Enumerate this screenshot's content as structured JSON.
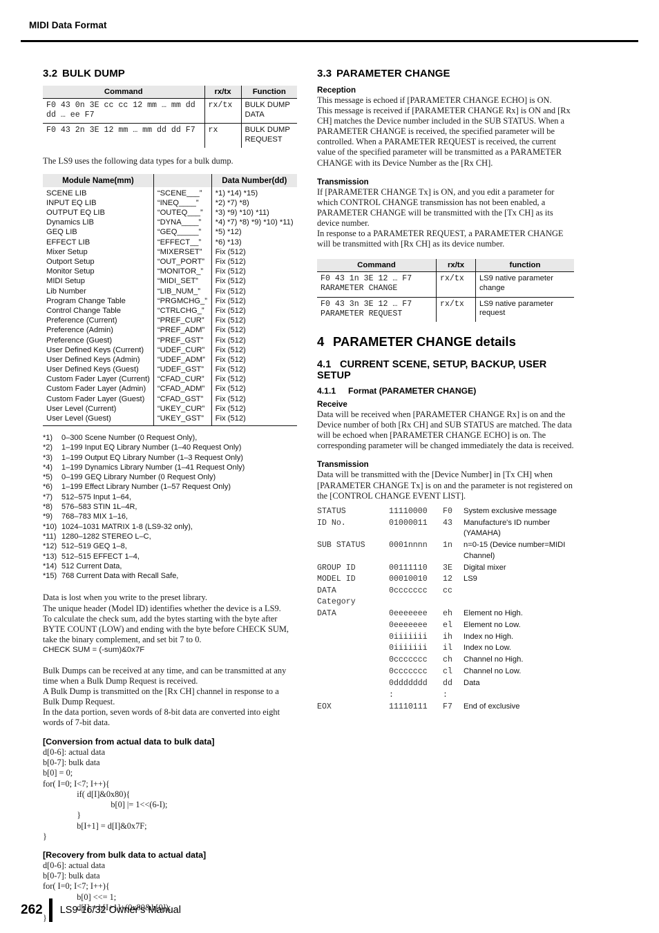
{
  "header": {
    "running_head": "MIDI Data Format"
  },
  "footer": {
    "page_number": "262",
    "manual_title": "LS9-16/32  Owner's Manual"
  },
  "left": {
    "bulk_dump": {
      "num": "3.2",
      "title": "BULK DUMP",
      "command_table": {
        "headers": [
          "Command",
          "rx/tx",
          "Function"
        ],
        "rows": [
          {
            "command": "F0 43 0n 3E cc cc 12 mm … mm dd\ndd … ee F7",
            "rxtx": "rx/tx",
            "function": "BULK DUMP DATA"
          },
          {
            "command": "F0 43 2n 3E 12 mm … mm dd dd F7",
            "rxtx": "rx",
            "function": "BULK DUMP REQUEST"
          }
        ]
      },
      "intro": "The LS9 uses the following data types for a bulk dump.",
      "module_table": {
        "headers": [
          "Module Name(mm)",
          "",
          "Data Number(dd)"
        ],
        "rows": [
          [
            "SCENE LIB",
            "“SCENE___”",
            "*1) *14) *15)"
          ],
          [
            "INPUT EQ LIB",
            "“INEQ____”",
            "*2) *7) *8)"
          ],
          [
            "OUTPUT EQ LIB",
            "“OUTEQ___”",
            "*3) *9) *10) *11)"
          ],
          [
            "Dynamics LIB",
            "“DYNA____”",
            "*4) *7) *8) *9) *10) *11)"
          ],
          [
            "GEQ LIB",
            "“GEQ_____”",
            "*5) *12)"
          ],
          [
            "EFFECT LIB",
            "“EFFECT__”",
            "*6) *13)"
          ],
          [
            "Mixer Setup",
            "“MIXERSET”",
            "Fix (512)"
          ],
          [
            "Outport Setup",
            "“OUT_PORT”",
            "Fix (512)"
          ],
          [
            "Monitor Setup",
            "“MONITOR_”",
            "Fix (512)"
          ],
          [
            "MIDI Setup",
            "“MIDI_SET”",
            "Fix (512)"
          ],
          [
            "Lib Number",
            "“LIB_NUM_”",
            "Fix (512)"
          ],
          [
            "Program Change Table",
            "“PRGMCHG_”",
            "Fix (512)"
          ],
          [
            "Control Change Table",
            "“CTRLCHG_”",
            "Fix (512)"
          ],
          [
            "Preference (Current)",
            "“PREF_CUR”",
            "Fix (512)"
          ],
          [
            "Preference (Admin)",
            "“PREF_ADM”",
            "Fix (512)"
          ],
          [
            "Preference (Guest)",
            "“PREF_GST”",
            "Fix (512)"
          ],
          [
            "User Defined Keys (Current)",
            "“UDEF_CUR”",
            "Fix (512)"
          ],
          [
            "User Defined Keys (Admin)",
            "“UDEF_ADM”",
            "Fix (512)"
          ],
          [
            "User Defined Keys (Guest)",
            "“UDEF_GST”",
            "Fix (512)"
          ],
          [
            "Custom Fader Layer (Current)",
            "“CFAD_CUR”",
            "Fix (512)"
          ],
          [
            "Custom Fader Layer (Admin)",
            "“CFAD_ADM”",
            "Fix (512)"
          ],
          [
            "Custom Fader Layer (Guest)",
            "“CFAD_GST”",
            "Fix (512)"
          ],
          [
            "User Level (Current)",
            "“UKEY_CUR”",
            "Fix (512)"
          ],
          [
            "User Level (Guest)",
            "“UKEY_GST”",
            "Fix (512)"
          ]
        ]
      },
      "notes": [
        {
          "mark": "*1)",
          "text": "0–300 Scene Number (0 Request Only),"
        },
        {
          "mark": "*2)",
          "text": "1–199 Input EQ Library Number (1–40 Request Only)"
        },
        {
          "mark": "*3)",
          "text": "1–199 Output EQ Library Number (1–3 Request Only)"
        },
        {
          "mark": "*4)",
          "text": "1–199 Dynamics Library Number (1–41 Request Only)"
        },
        {
          "mark": "*5)",
          "text": "0–199 GEQ Library Number (0 Request Only)"
        },
        {
          "mark": "*6)",
          "text": "1–199 Effect Library Number (1–57 Request Only)"
        },
        {
          "mark": "*7)",
          "text": "512–575 Input  1–64,"
        },
        {
          "mark": "*8)",
          "text": "576–583 STIN  1L–4R,"
        },
        {
          "mark": "*9)",
          "text": "768–783  MIX 1–16,"
        },
        {
          "mark": "*10)",
          "text": "1024–1031 MATRIX 1-8 (LS9-32 only),"
        },
        {
          "mark": "*11)",
          "text": "1280–1282 STEREO L–C,"
        },
        {
          "mark": "*12)",
          "text": "512–519 GEQ 1–8,"
        },
        {
          "mark": "*13)",
          "text": "512–515 EFFECT 1–4,"
        },
        {
          "mark": "*14)",
          "text": "512 Current Data,"
        },
        {
          "mark": "*15)",
          "text": "768 Current Data with Recall Safe,"
        }
      ],
      "para1": "Data is lost when you write to the preset library.\nThe unique header (Model ID) identifies whether the device is a LS9.\nTo calculate the check sum, add the bytes starting with the byte after BYTE COUNT (LOW) and ending with the byte before CHECK SUM, take the binary complement, and set bit 7 to 0.",
      "checksum_line": "CHECK SUM = (-sum)&0x7F",
      "para2": "Bulk Dumps can be received at any time, and can be transmitted at any time when a Bulk Dump Request is received.\nA Bulk Dump is transmitted on the [Rx CH] channel in response to a Bulk Dump Request.\nIn the data portion, seven words of 8-bit data are converted into eight words of 7-bit data.",
      "conversion_heading": "[Conversion from actual data to bulk data]",
      "conversion_code": "d[0-6]: actual data\nb[0-7]: bulk data\nb[0] = 0;\nfor( I=0; I<7; I++){\n                if( d[I]&0x80){\n                                b[0] |= 1<<(6-I);\n                }\n                b[I+1] = d[I]&0x7F;\n}",
      "recovery_heading": "[Recovery from bulk data to actual data]",
      "recovery_code": "d[0-6]: actual data\nb[0-7]: bulk data\nfor( I=0; I<7; I++){\n                b[0] <<= 1;\n                d[I] = b[I+1]+(0x80&b[0]);\n}"
    }
  },
  "right": {
    "parameter_change": {
      "num": "3.3",
      "title": "PARAMETER CHANGE",
      "reception_heading": "Reception",
      "reception_text": "This message is echoed if [PARAMETER CHANGE ECHO] is ON.\nThis message is received if [PARAMETER CHANGE Rx] is ON and [Rx CH] matches the Device number included in the SUB STATUS. When a PARAMETER CHANGE is received, the specified parameter will be controlled. When a PARAMETER REQUEST is received, the current value of the specified parameter will be transmitted as a PARAMETER CHANGE with its Device Number as the [Rx CH].",
      "transmission_heading": "Transmission",
      "transmission_text": "If [PARAMETER CHANGE Tx] is ON, and you edit a parameter for which CONTROL CHANGE transmission has not been enabled, a PARAMETER CHANGE will be transmitted with the [Tx CH] as its device number.\nIn response to a PARAMETER REQUEST, a PARAMETER CHANGE will be transmitted with [Rx CH] as its device number.",
      "command_table": {
        "headers": [
          "Command",
          "rx/tx",
          "function"
        ],
        "rows": [
          {
            "command": "F0 43 1n 3E 12 … F7\nRARAMETER CHANGE",
            "rxtx": "rx/tx",
            "function": "LS9 native parameter change"
          },
          {
            "command": "F0 43 3n 3E 12 … F7\nPARAMETER REQUEST",
            "rxtx": "rx/tx",
            "function": "LS9 native parameter request"
          }
        ]
      }
    },
    "details": {
      "num": "4",
      "title": "PARAMETER CHANGE details",
      "sub_num": "4.1",
      "sub_title": "CURRENT SCENE, SETUP, BACKUP, USER SETUP",
      "subsub_num": "4.1.1",
      "subsub_title": "Format (PARAMETER CHANGE)",
      "receive_heading": "Receive",
      "receive_text": "Data will be received when [PARAMETER CHANGE Rx] is on and the Device number of both [Rx CH] and SUB STATUS are matched. The data will be echoed when [PARAMETER CHANGE ECHO] is on. The corresponding parameter will be changed immediately the data is received.",
      "transmission_heading": "Transmission",
      "transmission_text": "Data will be transmitted with the [Device Number] in [Tx CH] when [PARAMETER CHANGE Tx] is on and the parameter is not registered on the [CONTROL CHANGE EVENT LIST].",
      "format_rows": [
        {
          "label": "STATUS",
          "binary": "11110000",
          "hex": "F0",
          "desc": "System exclusive message"
        },
        {
          "label": "ID No.",
          "binary": "01000011",
          "hex": "43",
          "desc": "Manufacture's ID number (YAMAHA)"
        },
        {
          "label": "SUB STATUS",
          "binary": "0001nnnn",
          "hex": "1n",
          "desc": "n=0-15 (Device number=MIDI Channel)"
        },
        {
          "label": "GROUP ID",
          "binary": "00111110",
          "hex": "3E",
          "desc": "Digital mixer"
        },
        {
          "label": "MODEL ID",
          "binary": "00010010",
          "hex": "12",
          "desc": "LS9"
        },
        {
          "label": "DATA\nCategory",
          "binary": "0ccccccc",
          "hex": "cc",
          "desc": ""
        },
        {
          "label": "DATA",
          "binary": "0eeeeeee",
          "hex": "eh",
          "desc": "Element no High."
        },
        {
          "label": "",
          "binary": "0eeeeeee",
          "hex": "el",
          "desc": "Element no Low."
        },
        {
          "label": "",
          "binary": "0iiiiiii",
          "hex": "ih",
          "desc": "Index no High."
        },
        {
          "label": "",
          "binary": "0iiiiiii",
          "hex": "il",
          "desc": "Index no Low."
        },
        {
          "label": "",
          "binary": "0ccccccc",
          "hex": "ch",
          "desc": "Channel no High."
        },
        {
          "label": "",
          "binary": "0ccccccc",
          "hex": "cl",
          "desc": "Channel no Low."
        },
        {
          "label": "",
          "binary": "0ddddddd",
          "hex": "dd",
          "desc": "Data"
        },
        {
          "label": "",
          "binary": ":",
          "hex": ":",
          "desc": ""
        },
        {
          "label": "EOX",
          "binary": "11110111",
          "hex": "F7",
          "desc": "End of exclusive"
        }
      ]
    }
  }
}
